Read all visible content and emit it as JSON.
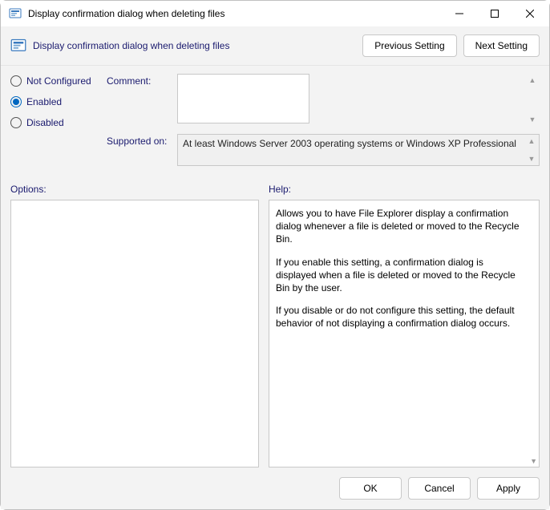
{
  "titlebar": {
    "title": "Display confirmation dialog when deleting files"
  },
  "header": {
    "title": "Display confirmation dialog when deleting files",
    "previous_label": "Previous Setting",
    "next_label": "Next Setting"
  },
  "state": {
    "options": [
      {
        "label": "Not Configured",
        "selected": false
      },
      {
        "label": "Enabled",
        "selected": true
      },
      {
        "label": "Disabled",
        "selected": false
      }
    ]
  },
  "fields": {
    "comment_label": "Comment:",
    "comment_value": "",
    "supported_label": "Supported on:",
    "supported_value": "At least Windows Server 2003 operating systems or Windows XP Professional"
  },
  "panes": {
    "options_label": "Options:",
    "help_label": "Help:",
    "help_paragraphs": [
      "Allows you to have File Explorer display a confirmation dialog whenever a file is deleted or moved to the Recycle Bin.",
      "If you enable this setting, a confirmation dialog is displayed when a file is deleted or moved to the Recycle Bin by the user.",
      "If you disable or do not configure this setting, the default behavior of not displaying a confirmation dialog occurs."
    ]
  },
  "footer": {
    "ok_label": "OK",
    "cancel_label": "Cancel",
    "apply_label": "Apply"
  }
}
